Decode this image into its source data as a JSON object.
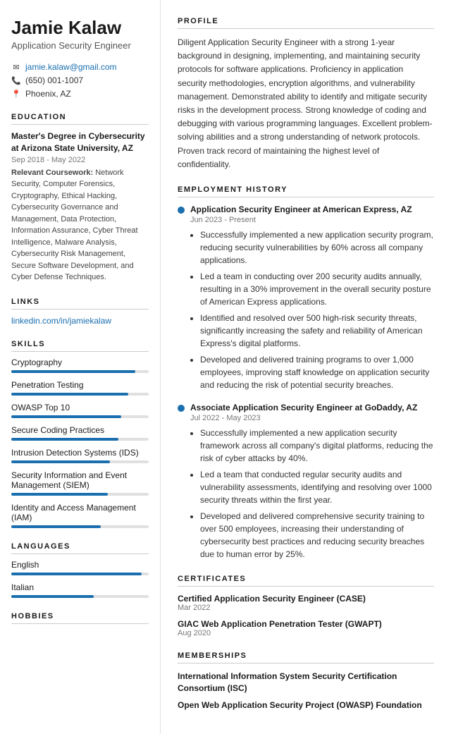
{
  "sidebar": {
    "name": "Jamie Kalaw",
    "job_title": "Application Security Engineer",
    "contact": {
      "email": "jamie.kalaw@gmail.com",
      "phone": "(650) 001-1007",
      "location": "Phoenix, AZ"
    },
    "education_section_label": "EDUCATION",
    "education": {
      "degree": "Master's Degree in Cybersecurity at Arizona State University, AZ",
      "dates": "Sep 2018 - May 2022",
      "coursework_label": "Relevant Coursework:",
      "coursework": "Network Security, Computer Forensics, Cryptography, Ethical Hacking, Cybersecurity Governance and Management, Data Protection, Information Assurance, Cyber Threat Intelligence, Malware Analysis, Cybersecurity Risk Management, Secure Software Development, and Cyber Defense Techniques."
    },
    "links_section_label": "LINKS",
    "links": [
      {
        "text": "linkedin.com/in/jamiekalaw",
        "url": "#"
      }
    ],
    "skills_section_label": "SKILLS",
    "skills": [
      {
        "name": "Cryptography",
        "pct": 90
      },
      {
        "name": "Penetration Testing",
        "pct": 85
      },
      {
        "name": "OWASP Top 10",
        "pct": 80
      },
      {
        "name": "Secure Coding Practices",
        "pct": 78
      },
      {
        "name": "Intrusion Detection Systems (IDS)",
        "pct": 72
      },
      {
        "name": "Security Information and Event Management (SIEM)",
        "pct": 70
      },
      {
        "name": "Identity and Access Management (IAM)",
        "pct": 65
      }
    ],
    "languages_section_label": "LANGUAGES",
    "languages": [
      {
        "name": "English",
        "pct": 95
      },
      {
        "name": "Italian",
        "pct": 60
      }
    ],
    "hobbies_section_label": "HOBBIES"
  },
  "main": {
    "profile_section_label": "PROFILE",
    "profile_text": "Diligent Application Security Engineer with a strong 1-year background in designing, implementing, and maintaining security protocols for software applications. Proficiency in application security methodologies, encryption algorithms, and vulnerability management. Demonstrated ability to identify and mitigate security risks in the development process. Strong knowledge of coding and debugging with various programming languages. Excellent problem-solving abilities and a strong understanding of network protocols. Proven track record of maintaining the highest level of confidentiality.",
    "employment_section_label": "EMPLOYMENT HISTORY",
    "jobs": [
      {
        "title": "Application Security Engineer at American Express, AZ",
        "dates": "Jun 2023 - Present",
        "bullets": [
          "Successfully implemented a new application security program, reducing security vulnerabilities by 60% across all company applications.",
          "Led a team in conducting over 200 security audits annually, resulting in a 30% improvement in the overall security posture of American Express applications.",
          "Identified and resolved over 500 high-risk security threats, significantly increasing the safety and reliability of American Express's digital platforms.",
          "Developed and delivered training programs to over 1,000 employees, improving staff knowledge on application security and reducing the risk of potential security breaches."
        ]
      },
      {
        "title": "Associate Application Security Engineer at GoDaddy, AZ",
        "dates": "Jul 2022 - May 2023",
        "bullets": [
          "Successfully implemented a new application security framework across all company's digital platforms, reducing the risk of cyber attacks by 40%.",
          "Led a team that conducted regular security audits and vulnerability assessments, identifying and resolving over 1000 security threats within the first year.",
          "Developed and delivered comprehensive security training to over 500 employees, increasing their understanding of cybersecurity best practices and reducing security breaches due to human error by 25%."
        ]
      }
    ],
    "certificates_section_label": "CERTIFICATES",
    "certificates": [
      {
        "name": "Certified Application Security Engineer (CASE)",
        "date": "Mar 2022"
      },
      {
        "name": "GIAC Web Application Penetration Tester (GWAPT)",
        "date": "Aug 2020"
      }
    ],
    "memberships_section_label": "MEMBERSHIPS",
    "memberships": [
      {
        "name": "International Information System Security Certification Consortium (ISC)"
      },
      {
        "name": "Open Web Application Security Project (OWASP) Foundation"
      }
    ]
  }
}
